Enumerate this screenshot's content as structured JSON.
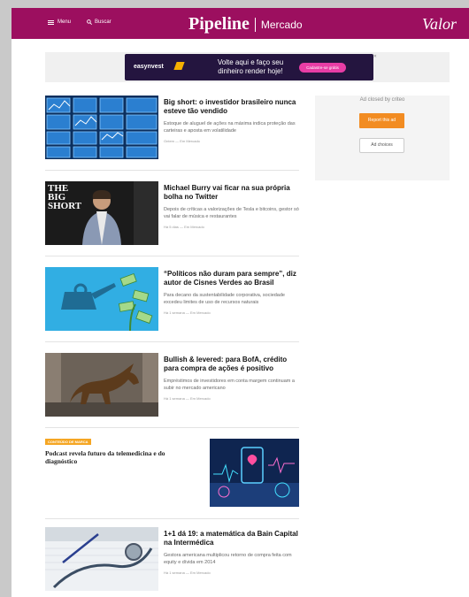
{
  "header": {
    "menu_label": "Menu",
    "search_label": "Buscar",
    "brand_main": "Pipeline",
    "brand_section": "Mercado",
    "logo": "Valor",
    "background_color": "#9c0f5f"
  },
  "top_ad": {
    "brand": "easynvest",
    "text": "Volte aqui e faço seu dinheiro render hoje!",
    "cta": "Cadastre-se grátis",
    "close": "✕"
  },
  "side_ad": {
    "closed_by": "Ad closed by criteo",
    "report": "Report this ad",
    "choices": "Ad choices"
  },
  "articles": [
    {
      "title": "Big short: o investidor brasileiro nunca esteve tão vendido",
      "desc": "Estoque de aluguel de ações na máxima indica proteção das carteiras e aposta em volatilidade",
      "meta": "Ontem — Em Mercado",
      "thumb_icon": "stock-screens-image"
    },
    {
      "title": "Michael Burry vai ficar na sua própria bolha no Twitter",
      "desc": "Depois de críticas a valorizações de Tesla e bitcoins, gestor só vai falar de música e restaurantes",
      "meta": "Há 5 dias — Em Mercado",
      "thumb_text": "THE BIG SHORT",
      "thumb_icon": "big-short-poster-image"
    },
    {
      "title": "“Políticos não duram para sempre”, diz autor de Cisnes Verdes ao Brasil",
      "desc": "Para decano da sustentabilidade corporativa, sociedade excedeu limites de uso de recursos naturais",
      "meta": "Há 1 semana — Em Mercado",
      "thumb_icon": "watering-money-image"
    },
    {
      "title": "Bullish & levered: para BofA, crédito para compra de ações é positivo",
      "desc": "Empréstimos de investidores em conta margem continuam a subir no mercado americano",
      "meta": "Há 1 semana — Em Mercado",
      "thumb_icon": "wall-street-bull-image"
    },
    {
      "title": "1+1 dá 19: a matemática da Bain Capital na Intermédica",
      "desc": "Gestora americana multiplicou retorno de compra feita com equity e dívida em 2014",
      "meta": "Há 1 semana — Em Mercado",
      "thumb_icon": "stethoscope-image"
    }
  ],
  "sponsored": {
    "badge": "CONTEÚDO DE MARCA",
    "title": "Podcast revela futuro da telemedicina e do diagnóstico",
    "thumb_icon": "digital-health-image"
  }
}
